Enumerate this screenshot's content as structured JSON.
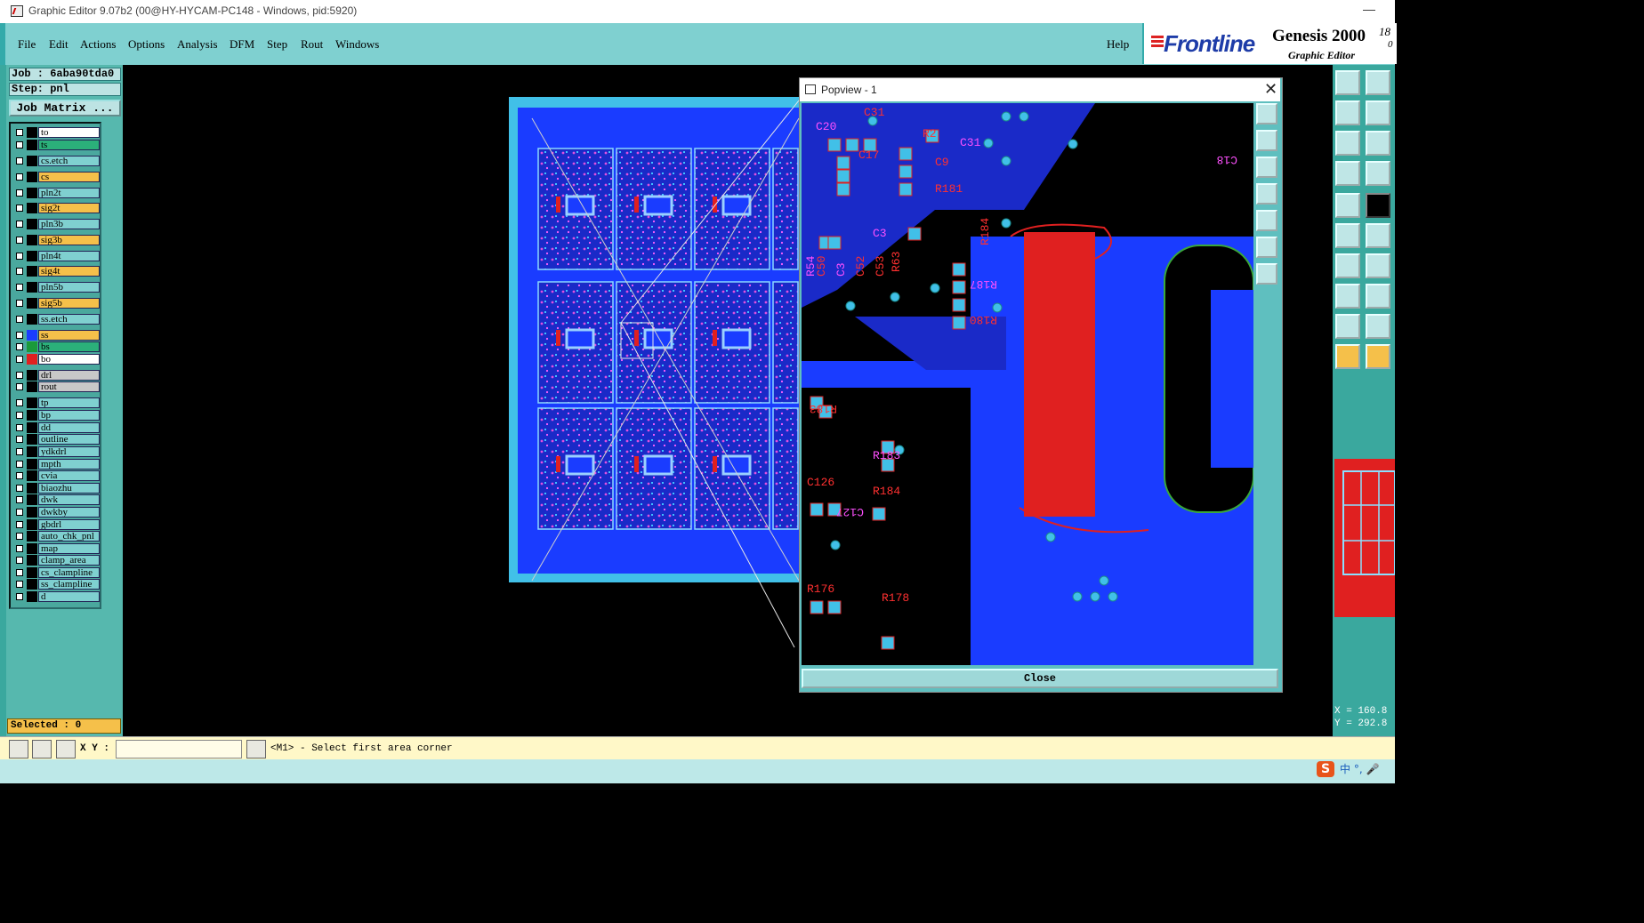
{
  "window": {
    "title": "Graphic Editor 9.07b2 (00@HY-HYCAM-PC148 - Windows, pid:5920)",
    "minimize": "—"
  },
  "menu": {
    "items": [
      {
        "label": "File"
      },
      {
        "label": "Edit"
      },
      {
        "label": "Actions"
      },
      {
        "label": "Options"
      },
      {
        "label": "Analysis"
      },
      {
        "label": "DFM"
      },
      {
        "label": "Step"
      },
      {
        "label": "Rout"
      },
      {
        "label": "Windows"
      }
    ],
    "help": "Help"
  },
  "branding": {
    "logo": "Frontline",
    "product": "Genesis 2000",
    "version_top": "18",
    "version_bottom": "0",
    "subtitle": "Graphic Editor"
  },
  "job": {
    "job_line": "Job : 6aba90tda0",
    "step_line": "Step: pnl",
    "matrix_button": "Job Matrix ..."
  },
  "layers": [
    {
      "name": "to",
      "color": "#ffffff",
      "swatch": "#000000"
    },
    {
      "name": "ts",
      "color": "#2bb07a",
      "swatch": "#000000"
    },
    {
      "name": "cs.etch",
      "color": "#7fd0d0",
      "swatch": "#000000"
    },
    {
      "name": "cs",
      "color": "#f5c04a",
      "swatch": "#000000"
    },
    {
      "name": "pln2t",
      "color": "#7fd0d0",
      "swatch": "#000000"
    },
    {
      "name": "sig2t",
      "color": "#f5c04a",
      "swatch": "#000000"
    },
    {
      "name": "pln3b",
      "color": "#7fd0d0",
      "swatch": "#000000"
    },
    {
      "name": "sig3b",
      "color": "#f5c04a",
      "swatch": "#000000"
    },
    {
      "name": "pln4t",
      "color": "#7fd0d0",
      "swatch": "#000000"
    },
    {
      "name": "sig4t",
      "color": "#f5c04a",
      "swatch": "#000000"
    },
    {
      "name": "pln5b",
      "color": "#7fd0d0",
      "swatch": "#000000"
    },
    {
      "name": "sig5b",
      "color": "#f5c04a",
      "swatch": "#000000"
    },
    {
      "name": "ss.etch",
      "color": "#7fd0d0",
      "swatch": "#000000"
    },
    {
      "name": "ss",
      "color": "#f5c04a",
      "swatch": "#1a3cff"
    },
    {
      "name": "bs",
      "color": "#2bb07a",
      "swatch": "#1a9a3a"
    },
    {
      "name": "bo",
      "color": "#ffffff",
      "swatch": "#e02020"
    },
    {
      "name": "drl",
      "color": "#c8c8c8",
      "swatch": "#000000"
    },
    {
      "name": "rout",
      "color": "#c8c8c8",
      "swatch": "#000000"
    },
    {
      "name": "tp",
      "color": "#7fd0d0",
      "swatch": "#000000"
    },
    {
      "name": "bp",
      "color": "#7fd0d0",
      "swatch": "#000000"
    },
    {
      "name": "dd",
      "color": "#7fd0d0",
      "swatch": "#000000"
    },
    {
      "name": "outline",
      "color": "#7fd0d0",
      "swatch": "#000000"
    },
    {
      "name": "ydkdrl",
      "color": "#7fd0d0",
      "swatch": "#000000"
    },
    {
      "name": "mpth",
      "color": "#7fd0d0",
      "swatch": "#000000"
    },
    {
      "name": "cvia",
      "color": "#7fd0d0",
      "swatch": "#000000"
    },
    {
      "name": "biaozhu",
      "color": "#7fd0d0",
      "swatch": "#000000"
    },
    {
      "name": "dwk",
      "color": "#7fd0d0",
      "swatch": "#000000"
    },
    {
      "name": "dwkby",
      "color": "#7fd0d0",
      "swatch": "#000000"
    },
    {
      "name": "gbdrl",
      "color": "#7fd0d0",
      "swatch": "#000000"
    },
    {
      "name": "auto_chk_pnl",
      "color": "#7fd0d0",
      "swatch": "#000000"
    },
    {
      "name": "map",
      "color": "#7fd0d0",
      "swatch": "#000000"
    },
    {
      "name": "clamp_area",
      "color": "#7fd0d0",
      "swatch": "#000000"
    },
    {
      "name": "cs_clampline",
      "color": "#7fd0d0",
      "swatch": "#000000"
    },
    {
      "name": "ss_clampline",
      "color": "#7fd0d0",
      "swatch": "#000000"
    },
    {
      "name": "d",
      "color": "#7fd0d0",
      "swatch": "#000000"
    }
  ],
  "selected": "Selected : 0",
  "bottom": {
    "xy_label": "X Y :",
    "xy_value": "",
    "prompt": "<M1> - Select first area corner"
  },
  "coords": {
    "x": "X = 160.8",
    "y": "Y = 292.8"
  },
  "popview": {
    "title": "Popview - 1",
    "close_button": "Close",
    "labels": [
      "C20",
      "C31",
      "C17",
      "C31",
      "R2",
      "C9",
      "C3",
      "R181",
      "C50",
      "C3",
      "C52",
      "C53",
      "R54",
      "R63",
      "R184",
      "R187",
      "R180",
      "R183",
      "R183",
      "R184",
      "C126",
      "C127",
      "R176",
      "R178",
      "C18"
    ]
  },
  "ime": {
    "logo": "S",
    "text": "中 °, 🎤"
  },
  "colors": {
    "panel": "#3aa89e",
    "menubar": "#7fd0d0",
    "pcb_blue": "#1a3cff",
    "pcb_red": "#e02020"
  }
}
